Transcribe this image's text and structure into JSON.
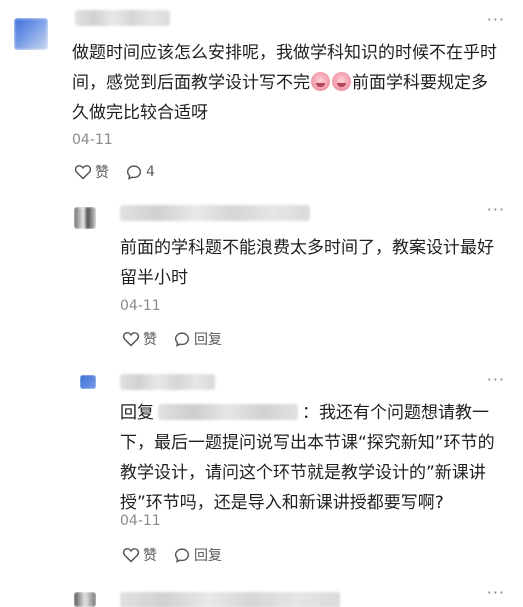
{
  "comments": [
    {
      "text_parts": [
        "做题时间应该怎么安排呢，我做学科知识的时候不在乎时间，感觉到后面教学设计写不完",
        "前面学科要规定多久做完比较合适呀"
      ],
      "emoji_count": 2,
      "date": "04-11",
      "like_label": "赞",
      "comment_count": "4"
    },
    {
      "text": "前面的学科题不能浪费太多时间了，教案设计最好留半小时",
      "date": "04-11",
      "like_label": "赞",
      "reply_label": "回复"
    },
    {
      "reply_prefix": "回复",
      "text": "：我还有个问题想请教一下，最后一题提问说写出本节课“探究新知”环节的教学设计，请问这个环节就是教学设计的”新课讲授”环节吗，还是导入和新课讲授都要写啊?",
      "date": "04-11",
      "like_label": "赞",
      "reply_label": "回复"
    }
  ],
  "more_label": "···",
  "colors": {
    "accent_blue": "#2f6fd6",
    "text": "#1f1f1f",
    "muted": "#8a8a8a"
  },
  "icons": {
    "like": "heart-outline-icon",
    "comment": "speech-bubble-icon",
    "more": "ellipsis-icon"
  }
}
